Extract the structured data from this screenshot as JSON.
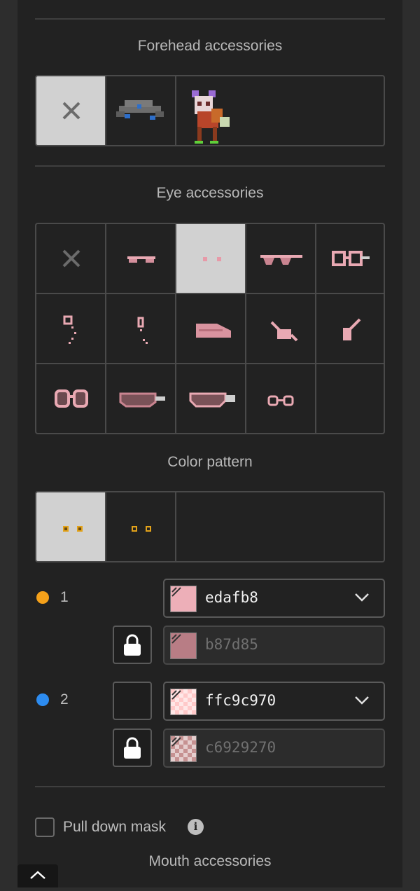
{
  "sections": {
    "forehead": {
      "title": "Forehead accessories"
    },
    "eye": {
      "title": "Eye accessories"
    },
    "pattern": {
      "title": "Color pattern"
    },
    "mouth": {
      "title": "Mouth accessories"
    }
  },
  "forehead_items": [
    {
      "name": "none-icon",
      "selected": true
    },
    {
      "name": "forehead-gray-cap-icon",
      "selected": false
    },
    {
      "name": "pony-preview-icon",
      "selected": false
    }
  ],
  "eye_items": [
    {
      "name": "none-icon",
      "selected": false
    },
    {
      "name": "eye-shades-thin-icon",
      "selected": false
    },
    {
      "name": "eye-dots-icon",
      "selected": true
    },
    {
      "name": "eye-glasses-icon",
      "selected": false
    },
    {
      "name": "eye-square-glasses-icon",
      "selected": false
    },
    {
      "name": "eye-monocle-icon",
      "selected": false
    },
    {
      "name": "eye-small-monocle-icon",
      "selected": false
    },
    {
      "name": "eye-visor-icon",
      "selected": false
    },
    {
      "name": "eye-patch-icon",
      "selected": false
    },
    {
      "name": "eye-side-patch-icon",
      "selected": false
    },
    {
      "name": "eye-round-glasses-icon",
      "selected": false
    },
    {
      "name": "eye-goggles-icon",
      "selected": false
    },
    {
      "name": "eye-goggles-strap-icon",
      "selected": false
    },
    {
      "name": "eye-small-round-glasses-icon",
      "selected": false
    },
    {
      "name": "empty-slot",
      "selected": false
    }
  ],
  "pattern_items": [
    {
      "name": "pattern-a-icon",
      "selected": true
    },
    {
      "name": "pattern-b-icon",
      "selected": false
    }
  ],
  "colors": [
    {
      "label": "1",
      "dot": "#f5a11a",
      "value": "edafb8",
      "swatch": "#edafb8",
      "outline": "b87d85",
      "outline_swatch": "#b87d85",
      "transparent": false
    },
    {
      "label": "2",
      "dot": "#2d8cf0",
      "value": "ffc9c970",
      "swatch": "#ffc9c9",
      "outline": "c6929270",
      "outline_swatch": "#c69292",
      "transparent": true
    }
  ],
  "pull_down_mask": {
    "label": "Pull down mask",
    "checked": false
  },
  "icons": {
    "info": "i",
    "lock": "lock-icon",
    "chevron": "chevron-down-icon",
    "scroll_top": "chevron-up-icon"
  }
}
